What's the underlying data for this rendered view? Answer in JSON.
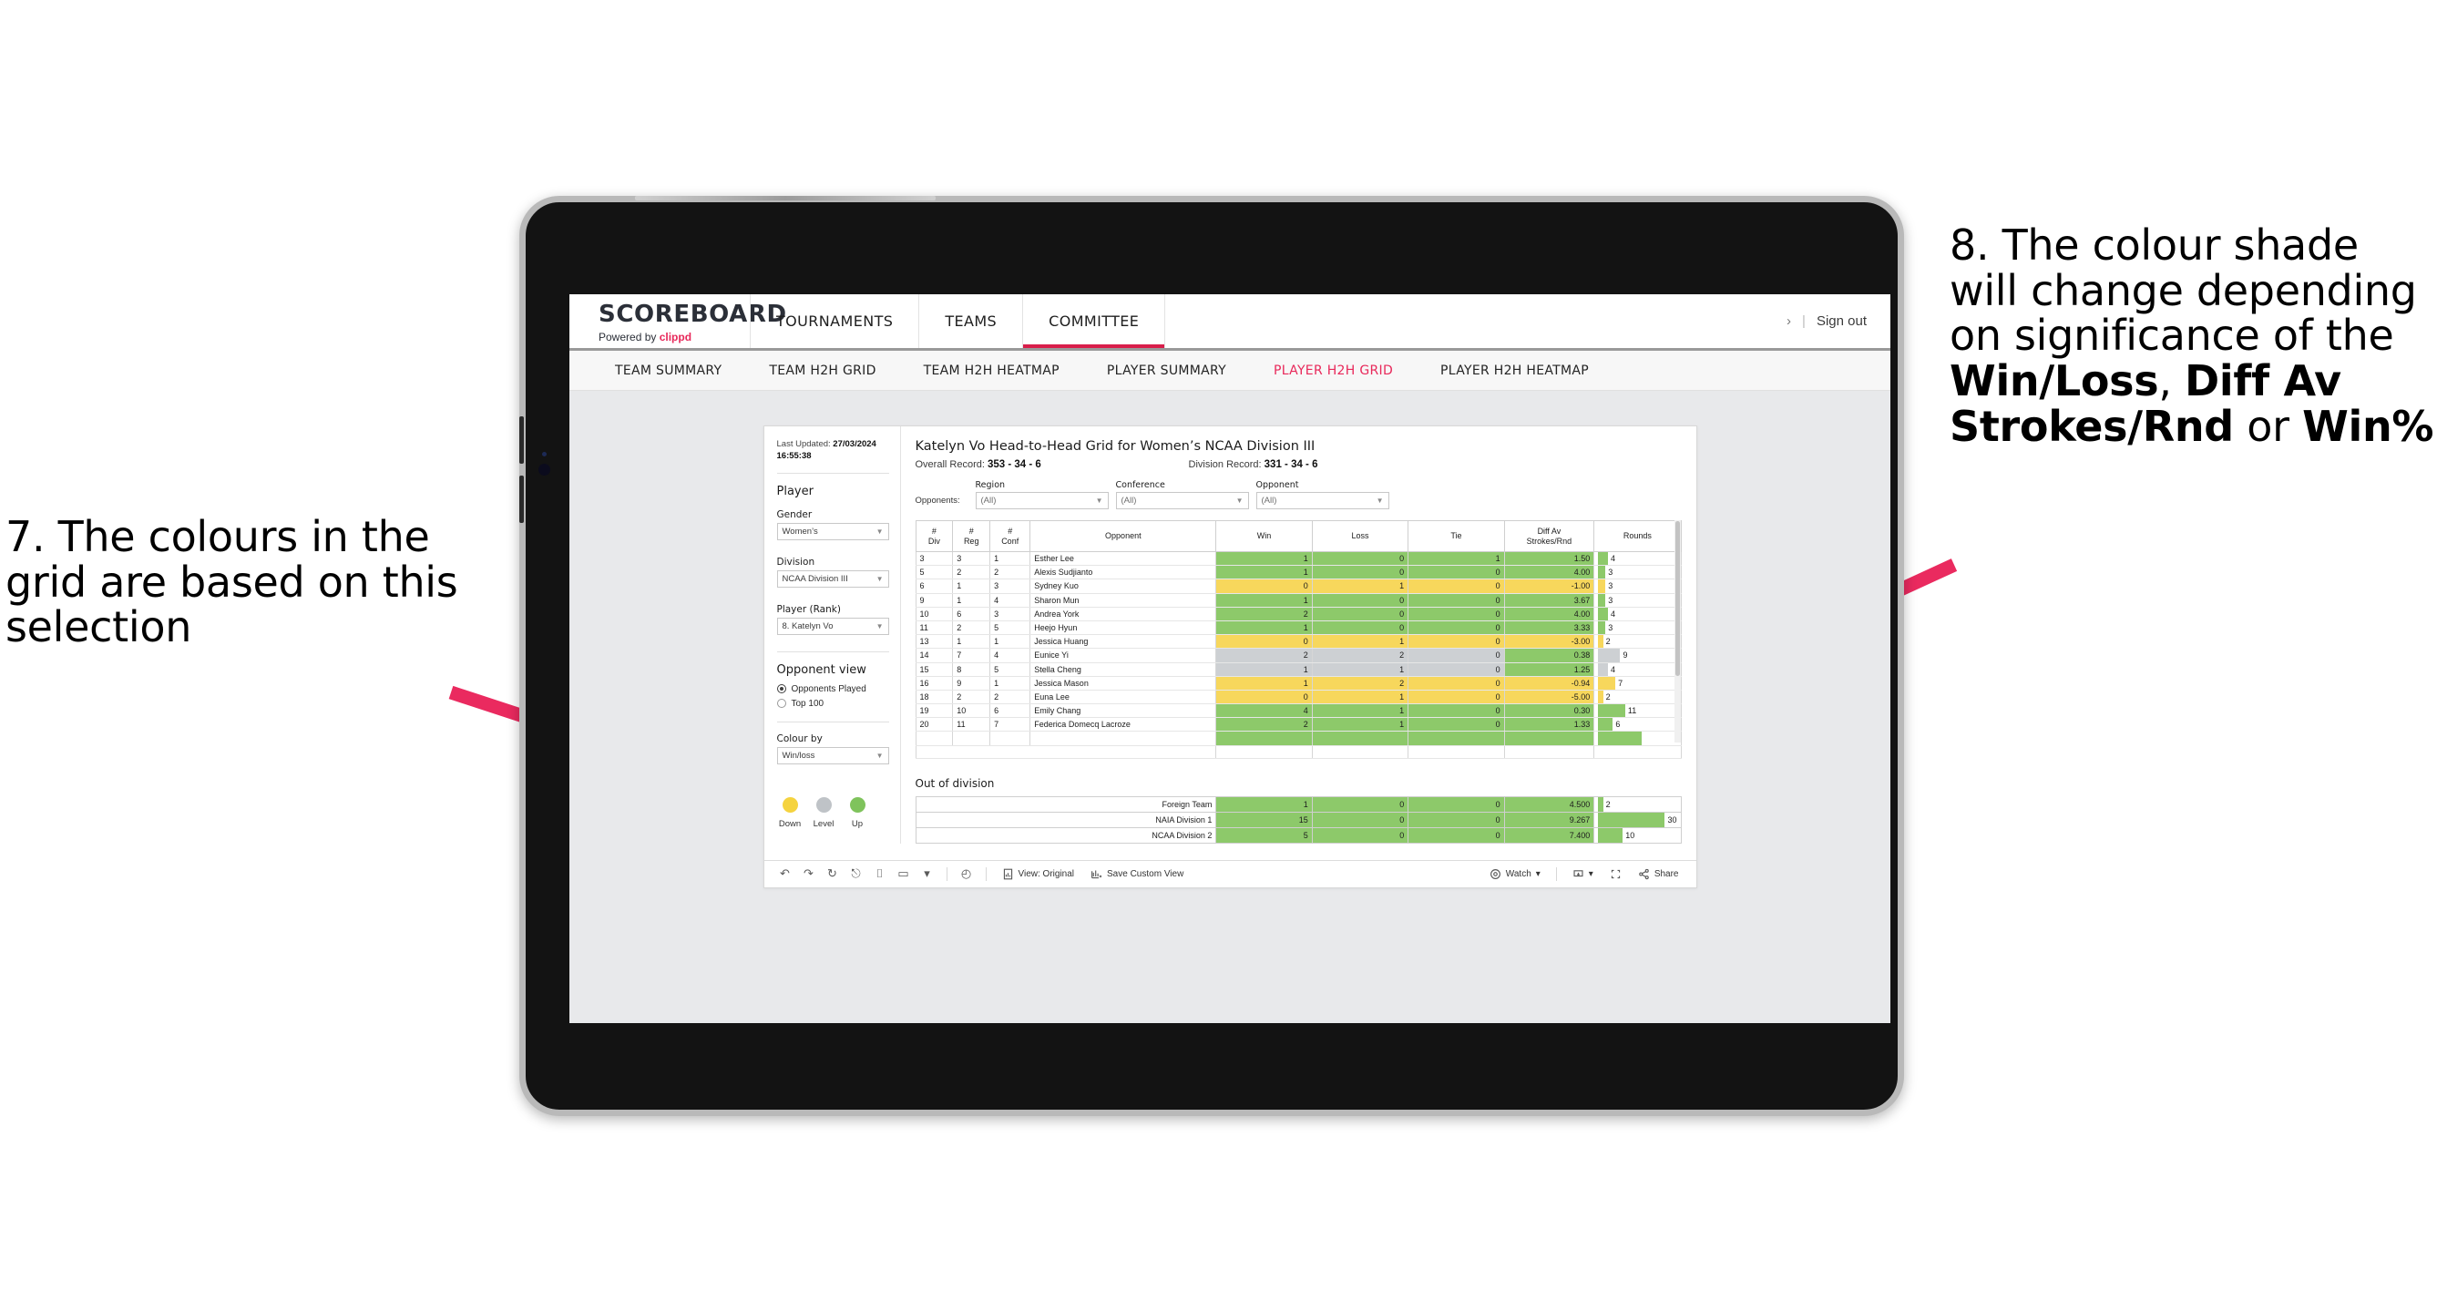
{
  "annotations": {
    "left": "7. The colours in the grid are based on this selection",
    "right_prefix": "8. The colour shade will change depending on significance of the ",
    "right_bold_1": "Win/Loss",
    "right_mid_1": ", ",
    "right_bold_2": "Diff Av Strokes/Rnd",
    "right_mid_2": " or ",
    "right_bold_3": "Win%",
    "arrow_color": "#ea2a5f"
  },
  "app": {
    "brand": {
      "title": "SCOREBOARD",
      "powered_prefix": "Powered by ",
      "powered_brand": "clippd"
    },
    "topnav": [
      {
        "label": "TOURNAMENTS",
        "active": false
      },
      {
        "label": "TEAMS",
        "active": false
      },
      {
        "label": "COMMITTEE",
        "active": true
      }
    ],
    "topbar_right": {
      "chevron": "›",
      "separator": "|",
      "sign_out": "Sign out"
    },
    "subnav": [
      {
        "label": "TEAM SUMMARY",
        "active": false
      },
      {
        "label": "TEAM H2H GRID",
        "active": false
      },
      {
        "label": "TEAM H2H HEATMAP",
        "active": false
      },
      {
        "label": "PLAYER SUMMARY",
        "active": false
      },
      {
        "label": "PLAYER H2H GRID",
        "active": true
      },
      {
        "label": "PLAYER H2H HEATMAP",
        "active": false
      }
    ],
    "accent": "#e8285a"
  },
  "filters": {
    "last_updated_label": "Last Updated:",
    "last_updated_value": "27/03/2024 16:55:38",
    "player_heading": "Player",
    "gender": {
      "label": "Gender",
      "value": "Women’s"
    },
    "division": {
      "label": "Division",
      "value": "NCAA Division III"
    },
    "player_rank": {
      "label": "Player (Rank)",
      "value": "8. Katelyn Vo"
    },
    "opponent_view": {
      "heading": "Opponent view",
      "options": [
        {
          "label": "Opponents Played",
          "selected": true
        },
        {
          "label": "Top 100",
          "selected": false
        }
      ]
    },
    "colour_by": {
      "label": "Colour by",
      "value": "Win/loss"
    },
    "legend": [
      {
        "label": "Down",
        "color": "#f5d33f"
      },
      {
        "label": "Level",
        "color": "#bfc3c7"
      },
      {
        "label": "Up",
        "color": "#7fc35c"
      }
    ]
  },
  "viz": {
    "title": "Katelyn Vo Head-to-Head Grid for Women’s NCAA Division III",
    "overall_record_label": "Overall Record:",
    "overall_record_value": "353 -  34 - 6",
    "division_record_label": "Division Record:",
    "division_record_value": "331 -  34 - 6",
    "opponents_label": "Opponents:",
    "opponent_filters": [
      {
        "label": "Region",
        "value": "(All)"
      },
      {
        "label": "Conference",
        "value": "(All)"
      },
      {
        "label": "Opponent",
        "value": "(All)"
      }
    ],
    "columns": [
      "# Div",
      "# Reg",
      "# Conf",
      "Opponent",
      "Win",
      "Loss",
      "Tie",
      "Diff Av Strokes/Rnd",
      "Rounds"
    ],
    "column_multiline": [
      [
        "#",
        "Div"
      ],
      [
        "#",
        "Reg"
      ],
      [
        "#",
        "Conf"
      ],
      [
        "Opponent"
      ],
      [
        "Win"
      ],
      [
        "Loss"
      ],
      [
        "Tie"
      ],
      [
        "Diff Av",
        "Strokes/Rnd"
      ],
      [
        "Rounds"
      ]
    ],
    "out_of_division_title": "Out of division"
  },
  "chart_data": {
    "type": "table",
    "title": "Katelyn Vo Head-to-Head Grid for Women’s NCAA Division III",
    "columns": [
      "#Div",
      "#Reg",
      "#Conf",
      "Opponent",
      "Win",
      "Loss",
      "Tie",
      "Diff Av Strokes/Rnd",
      "Rounds"
    ],
    "rows": [
      {
        "div": "3",
        "reg": "3",
        "conf": "1",
        "opponent": "Esther Lee",
        "win": "1",
        "loss": "0",
        "tie": "1",
        "diff": "1.50",
        "rounds": "4",
        "color": "#8dc96a",
        "diff_color": "#8dc96a"
      },
      {
        "div": "5",
        "reg": "2",
        "conf": "2",
        "opponent": "Alexis Sudjianto",
        "win": "1",
        "loss": "0",
        "tie": "0",
        "diff": "4.00",
        "rounds": "3",
        "color": "#8dc96a",
        "diff_color": "#8dc96a"
      },
      {
        "div": "6",
        "reg": "1",
        "conf": "3",
        "opponent": "Sydney Kuo",
        "win": "0",
        "loss": "1",
        "tie": "0",
        "diff": "-1.00",
        "rounds": "3",
        "color": "#f7d75c",
        "diff_color": "#f7d75c"
      },
      {
        "div": "9",
        "reg": "1",
        "conf": "4",
        "opponent": "Sharon Mun",
        "win": "1",
        "loss": "0",
        "tie": "0",
        "diff": "3.67",
        "rounds": "3",
        "color": "#8dc96a",
        "diff_color": "#8dc96a"
      },
      {
        "div": "10",
        "reg": "6",
        "conf": "3",
        "opponent": "Andrea York",
        "win": "2",
        "loss": "0",
        "tie": "0",
        "diff": "4.00",
        "rounds": "4",
        "color": "#8dc96a",
        "diff_color": "#8dc96a"
      },
      {
        "div": "11",
        "reg": "2",
        "conf": "5",
        "opponent": "Heejo Hyun",
        "win": "1",
        "loss": "0",
        "tie": "0",
        "diff": "3.33",
        "rounds": "3",
        "color": "#8dc96a",
        "diff_color": "#8dc96a"
      },
      {
        "div": "13",
        "reg": "1",
        "conf": "1",
        "opponent": "Jessica Huang",
        "win": "0",
        "loss": "1",
        "tie": "0",
        "diff": "-3.00",
        "rounds": "2",
        "color": "#f7d75c",
        "diff_color": "#f7d75c"
      },
      {
        "div": "14",
        "reg": "7",
        "conf": "4",
        "opponent": "Eunice Yi",
        "win": "2",
        "loss": "2",
        "tie": "0",
        "diff": "0.38",
        "rounds": "9",
        "color": "#cdd0d3",
        "diff_color": "#8dc96a"
      },
      {
        "div": "15",
        "reg": "8",
        "conf": "5",
        "opponent": "Stella Cheng",
        "win": "1",
        "loss": "1",
        "tie": "0",
        "diff": "1.25",
        "rounds": "4",
        "color": "#cdd0d3",
        "diff_color": "#8dc96a"
      },
      {
        "div": "16",
        "reg": "9",
        "conf": "1",
        "opponent": "Jessica Mason",
        "win": "1",
        "loss": "2",
        "tie": "0",
        "diff": "-0.94",
        "rounds": "7",
        "color": "#f7d75c",
        "diff_color": "#f7d75c"
      },
      {
        "div": "18",
        "reg": "2",
        "conf": "2",
        "opponent": "Euna Lee",
        "win": "0",
        "loss": "1",
        "tie": "0",
        "diff": "-5.00",
        "rounds": "2",
        "color": "#f7d75c",
        "diff_color": "#f7d75c"
      },
      {
        "div": "19",
        "reg": "10",
        "conf": "6",
        "opponent": "Emily Chang",
        "win": "4",
        "loss": "1",
        "tie": "0",
        "diff": "0.30",
        "rounds": "11",
        "color": "#8dc96a",
        "diff_color": "#8dc96a"
      },
      {
        "div": "20",
        "reg": "11",
        "conf": "7",
        "opponent": "Federica Domecq Lacroze",
        "win": "2",
        "loss": "1",
        "tie": "0",
        "diff": "1.33",
        "rounds": "6",
        "color": "#8dc96a",
        "diff_color": "#8dc96a"
      }
    ],
    "out_of_division": [
      {
        "name": "Foreign Team",
        "win": "1",
        "loss": "0",
        "tie": "0",
        "diff": "4.500",
        "rounds": "2",
        "color": "#8dc96a"
      },
      {
        "name": "NAIA Division 1",
        "win": "15",
        "loss": "0",
        "tie": "0",
        "diff": "9.267",
        "rounds": "30",
        "color": "#8dc96a"
      },
      {
        "name": "NCAA Division 2",
        "win": "5",
        "loss": "0",
        "tie": "0",
        "diff": "7.400",
        "rounds": "10",
        "color": "#8dc96a"
      }
    ],
    "rounds_max": 32
  },
  "toolbar": {
    "view_label": "View: Original",
    "save_label": "Save Custom View",
    "watch_label": "Watch",
    "share_label": "Share",
    "caret": "▾"
  }
}
